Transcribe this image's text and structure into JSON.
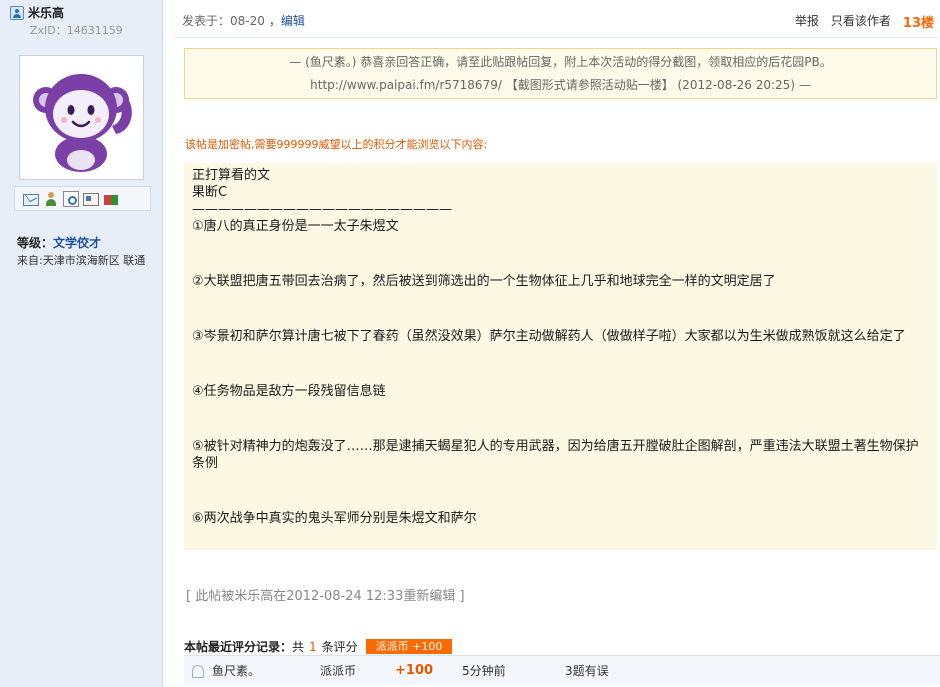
{
  "user": {
    "name": "米乐高",
    "zxid": "ZxID：14631159",
    "level_label": "等级：",
    "level_value": "文学佼才",
    "from": "来自:天津市滨海新区 联通"
  },
  "post": {
    "meta": "发表于：08-20",
    "edit_link": "，编辑",
    "report": "举报",
    "only_author": "只看该作者",
    "floor": "13楼",
    "notice": "— (鱼尺素。) 恭喜亲回答正确，请至此贴跟帖回复，附上本次活动的得分截图，领取相应的后花园PB。http://www.paipai.fm/r5718679/ 【截图形式请参照活动贴一楼】 (2012-08-26 20:25) —",
    "locked": "该帖是加密帖,需要999999威望以上的积分才能浏览以下内容:",
    "lines": [
      "正打算看的文",
      "果断C",
      "————————————————————",
      "①唐八的真正身份是一一太子朱煜文",
      "②大联盟把唐五带回去治病了，然后被送到筛选出的一个生物体征上几乎和地球完全一样的文明定居了",
      "③岑景初和萨尔算计唐七被下了春药（虽然没效果）萨尔主动做解药人（做做样子啦）大家都以为生米做成熟饭就这么给定了",
      "④任务物品是敌方一段残留信息链",
      "⑤被针对精神力的炮轰没了……那是逮捕天蝎星犯人的专用武器，因为给唐五开膛破肚企图解剖，严重违法大联盟土著生物保护条例",
      "⑥两次战争中真实的鬼头军师分别是朱煜文和萨尔"
    ],
    "edited": "[ 此帖被米乐高在2012-08-24 12:33重新编辑 ]"
  },
  "rating": {
    "label": "本帖最近评分记录：",
    "total_prefix": "共",
    "count": "1",
    "total_suffix": "条评分",
    "badge": "派派币  +100",
    "rows": [
      {
        "name": "鱼尺素。",
        "type": "派派币",
        "value": "+100",
        "time": "5分钟前",
        "reason": "3题有误"
      }
    ]
  },
  "colors": {
    "accent_orange": "#ff6600",
    "link_blue": "#1f4fa0",
    "sidebar_bg": "#e8eef7"
  }
}
